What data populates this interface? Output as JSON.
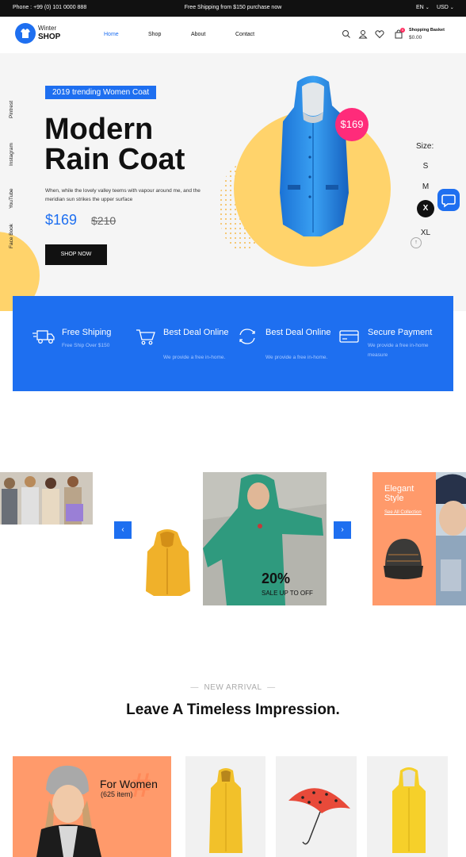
{
  "topbar": {
    "phone": "Phone : +99 (0) 101 0000 888",
    "shipping": "Free Shipping from $150 purchase now",
    "language": "EN",
    "currency": "USD"
  },
  "header": {
    "logo_line1": "Winter",
    "logo_line2": "SHOP",
    "nav": [
      "Home",
      "Shop",
      "About",
      "Contact"
    ],
    "basket_title": "Shopping Basket",
    "basket_total": "$0.00",
    "basket_count": "0"
  },
  "hero": {
    "tag": "2019 trending Women Coat",
    "title_line1": "Modern",
    "title_line2": "Rain Coat",
    "description": "When, while the lovely valley teems with vapour around me, and the meridian sun strikes the upper surface",
    "price": "$169",
    "old_price": "$210",
    "cta": "SHOP NOW",
    "price_bubble": "$169",
    "social": [
      "Pintrest",
      "Instagram",
      "YouTube",
      "Face Book"
    ],
    "size_label": "Size:",
    "sizes": [
      "S",
      "M",
      "X",
      "XL"
    ],
    "selected_size": "X"
  },
  "features": [
    {
      "title": "Free Shiping",
      "desc": "Free Ship Over $150"
    },
    {
      "title": "Best Deal Online",
      "desc": "We provide a free in-home."
    },
    {
      "title": "Best Deal Online",
      "desc": "We provide a free in-home."
    },
    {
      "title": "Secure Payment",
      "desc": "We provide a free in-home measure"
    }
  ],
  "carousel": {
    "sale_percent": "20%",
    "sale_text": "SALE UP TO OFF",
    "elegant_title": "Elegant Style",
    "elegant_link": "See All Collection"
  },
  "new_arrival": {
    "subtitle": "NEW ARRIVAL",
    "title": "Leave A Timeless Impression.",
    "women_title": "For Women",
    "women_count": "(625 item)"
  },
  "colors": {
    "accent": "#1e6ff0",
    "yellow": "#ffd36b",
    "pink": "#ff2b7a",
    "peach": "#ff9a6b"
  }
}
